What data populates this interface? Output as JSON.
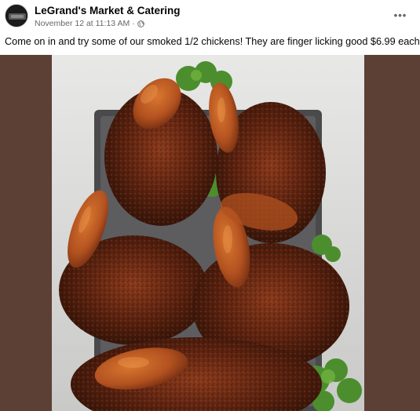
{
  "post": {
    "page_name": "LeGrand's Market & Catering",
    "timestamp": "November 12 at 11:13 AM",
    "separator": "·",
    "audience_icon": "globe-icon",
    "more_icon": "more-options-icon",
    "more_label": "•••",
    "caption": "Come on in and try some of our smoked 1/2 chickens! They are finger licking good $6.99 each"
  },
  "colors": {
    "photo_border": "#5c4036",
    "meta_text": "#65676b",
    "name_text": "#050505"
  }
}
